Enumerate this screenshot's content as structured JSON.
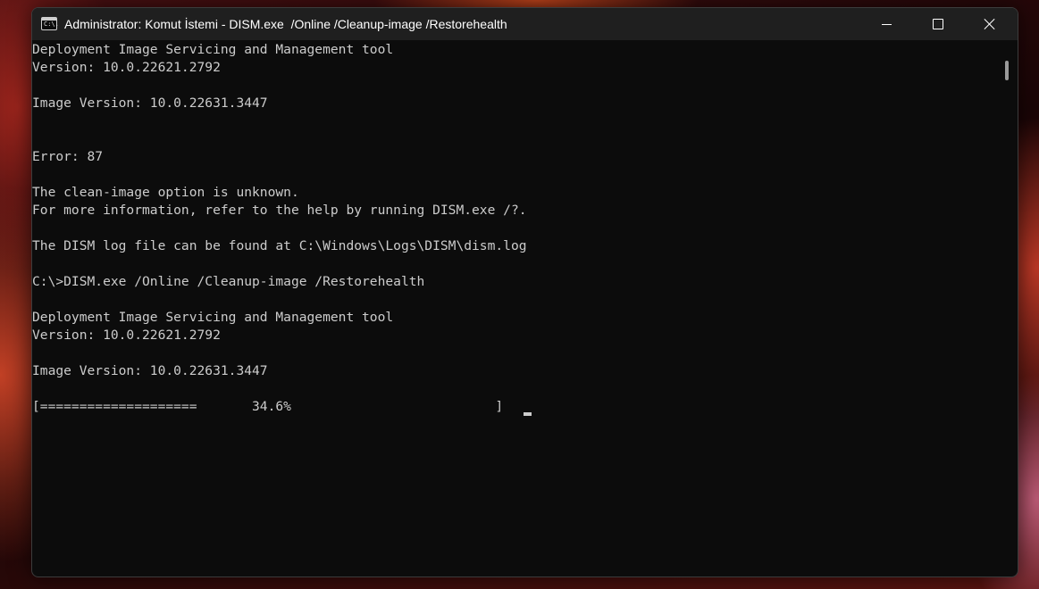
{
  "window": {
    "title": "Administrator: Komut İstemi - DISM.exe  /Online /Cleanup-image /Restorehealth",
    "icon_label": "C:\\."
  },
  "console": {
    "lines": [
      "Deployment Image Servicing and Management tool",
      "Version: 10.0.22621.2792",
      "",
      "Image Version: 10.0.22631.3447",
      "",
      "",
      "Error: 87",
      "",
      "The clean-image option is unknown.",
      "For more information, refer to the help by running DISM.exe /?.",
      "",
      "The DISM log file can be found at C:\\Windows\\Logs\\DISM\\dism.log",
      "",
      "C:\\>DISM.exe /Online /Cleanup-image /Restorehealth",
      "",
      "Deployment Image Servicing and Management tool",
      "Version: 10.0.22621.2792",
      "",
      "Image Version: 10.0.22631.3447",
      "",
      "[====================       34.6%                          ] "
    ],
    "progress_percent": 34.6
  },
  "colors": {
    "console_bg": "#0c0c0c",
    "console_fg": "#cccccc",
    "titlebar_bg": "#1f1f1f"
  },
  "icons": [
    "cmd-app-icon",
    "minimize-icon",
    "maximize-icon",
    "close-icon"
  ]
}
